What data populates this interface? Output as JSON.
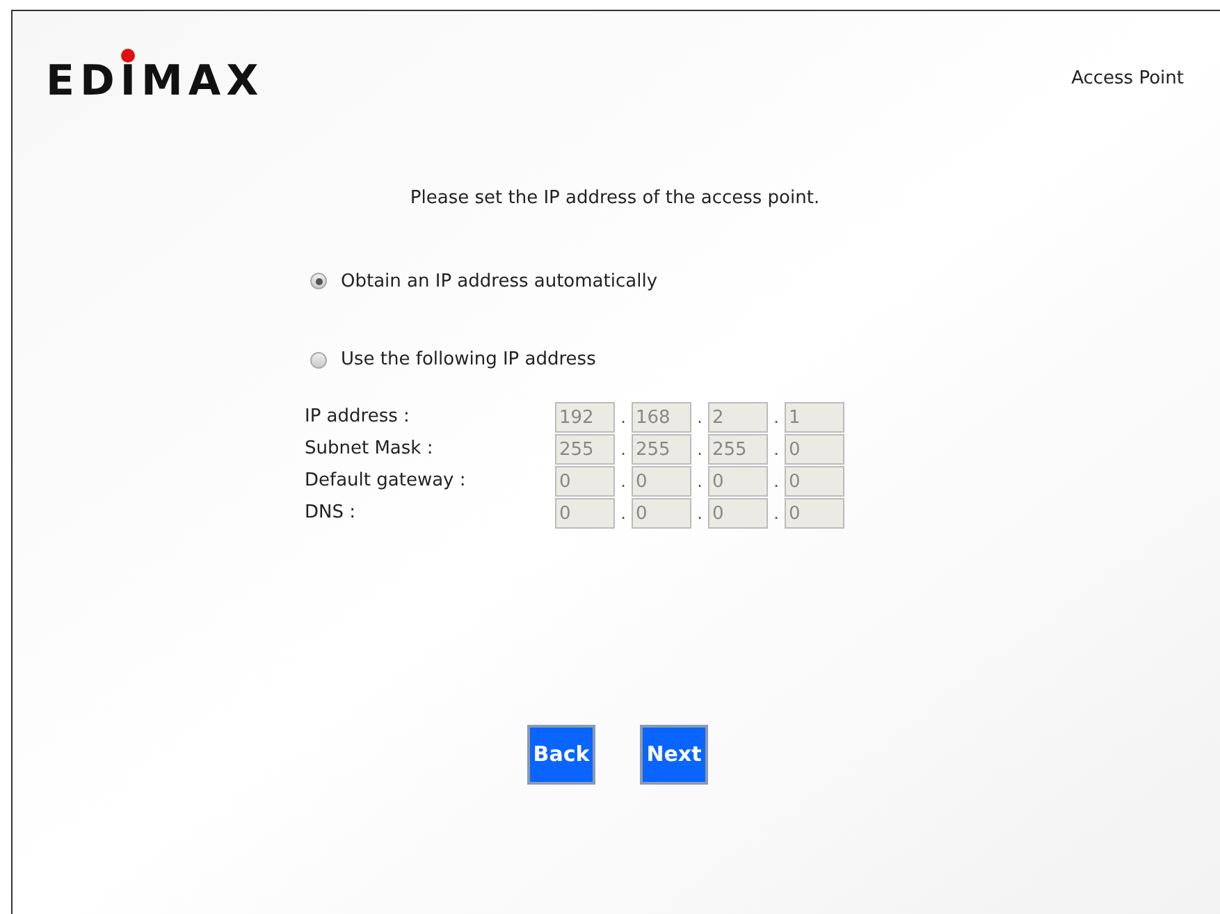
{
  "header": {
    "logo": "EDIMAX",
    "mode": "Access Point"
  },
  "instruction": "Please set the IP address of the access point.",
  "options": [
    {
      "label": "Obtain an IP address automatically",
      "selected": true
    },
    {
      "label": "Use the following IP address",
      "selected": false
    }
  ],
  "fields": [
    {
      "label": "IP address :",
      "octets": [
        "192",
        "168",
        "2",
        "1"
      ],
      "disabled": true
    },
    {
      "label": "Subnet Mask :",
      "octets": [
        "255",
        "255",
        "255",
        "0"
      ],
      "disabled": true
    },
    {
      "label": "Default gateway :",
      "octets": [
        "0",
        "0",
        "0",
        "0"
      ],
      "disabled": true
    },
    {
      "label": "DNS :",
      "octets": [
        "0",
        "0",
        "0",
        "0"
      ],
      "disabled": true
    }
  ],
  "separator": ".",
  "buttons": [
    "Back",
    "Next"
  ]
}
